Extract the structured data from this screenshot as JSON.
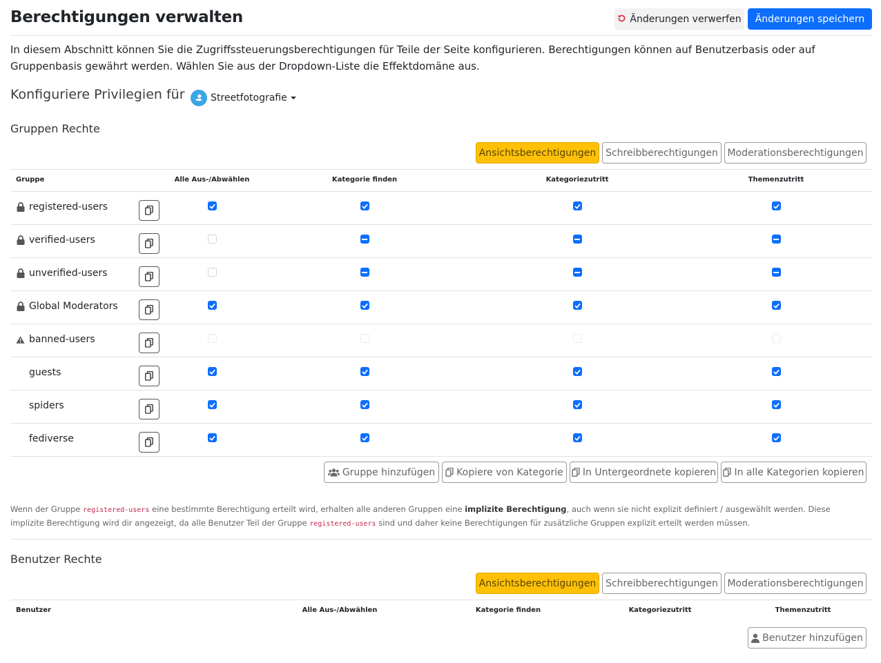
{
  "page": {
    "title": "Berechtigungen verwalten",
    "discard_label": "Änderungen verwerfen",
    "save_label": "Änderungen speichern",
    "intro": "In diesem Abschnitt können Sie die Zugriffssteuerungsberechtigungen für Teile der Seite konfigurieren. Berechtigungen können auf Benutzerbasis oder auf Gruppenbasis gewährt werden. Wählen Sie aus der Dropdown-Liste die Effektdomäne aus.",
    "configure_label": "Konfiguriere Privilegien für",
    "domain_selected": "Streetfotografie"
  },
  "colors": {
    "primary": "#0d6efd",
    "warning": "#ffc107",
    "danger": "#dc3545",
    "domain_logo": "#3aa6e6"
  },
  "groups_section": {
    "title": "Gruppen Rechte",
    "tabs": [
      "Ansichtsberechtigungen",
      "Schreibberechtigungen",
      "Moderationsberechtigungen"
    ],
    "active_tab": 0,
    "columns": [
      "Gruppe",
      "Alle Aus-/Abwählen",
      "Kategorie finden",
      "Kategoriezutritt",
      "Themenzutritt"
    ],
    "rows": [
      {
        "name": "registered-users",
        "icon": "lock-icon",
        "states": [
          "on",
          "on",
          "on",
          "on"
        ]
      },
      {
        "name": "verified-users",
        "icon": "lock-icon",
        "states": [
          "off",
          "ind",
          "ind",
          "ind"
        ]
      },
      {
        "name": "unverified-users",
        "icon": "lock-icon",
        "states": [
          "off",
          "ind",
          "ind",
          "ind"
        ]
      },
      {
        "name": "Global Moderators",
        "icon": "lock-icon",
        "states": [
          "on",
          "on",
          "on",
          "on"
        ]
      },
      {
        "name": "banned-users",
        "icon": "warning-icon",
        "states": [
          "dis",
          "dis",
          "dis",
          "dis"
        ]
      },
      {
        "name": "guests",
        "icon": "",
        "states": [
          "on",
          "on",
          "on",
          "on"
        ]
      },
      {
        "name": "spiders",
        "icon": "",
        "states": [
          "on",
          "on",
          "on",
          "on"
        ]
      },
      {
        "name": "fediverse",
        "icon": "",
        "states": [
          "on",
          "on",
          "on",
          "on"
        ]
      }
    ],
    "actions": {
      "add_group": "Gruppe hinzufügen",
      "copy_from": "Kopiere von Kategorie",
      "copy_children": "In Untergeordnete kopieren",
      "copy_all": "In alle Kategorien kopieren"
    }
  },
  "note": {
    "p1": "Wenn der Gruppe ",
    "code1": "registered-users",
    "p2": " eine bestimmte Berechtigung erteilt wird, erhalten alle anderen Gruppen eine ",
    "bold": "implizite Berechtigung",
    "p3": ", auch wenn sie nicht explizit definiert / ausgewählt werden. Diese implizite Berechtigung wird dir angezeigt, da alle Benutzer Teil der Gruppe ",
    "code2": "registered-users",
    "p4": " sind und daher keine Berechtigungen für zusätzliche Gruppen explizit erteilt werden müssen."
  },
  "users_section": {
    "title": "Benutzer Rechte",
    "tabs": [
      "Ansichtsberechtigungen",
      "Schreibberechtigungen",
      "Moderationsberechtigungen"
    ],
    "active_tab": 0,
    "columns": [
      "Benutzer",
      "Alle Aus-/Abwählen",
      "Kategorie finden",
      "Kategoriezutritt",
      "Themenzutritt"
    ],
    "add_user": "Benutzer hinzufügen"
  }
}
